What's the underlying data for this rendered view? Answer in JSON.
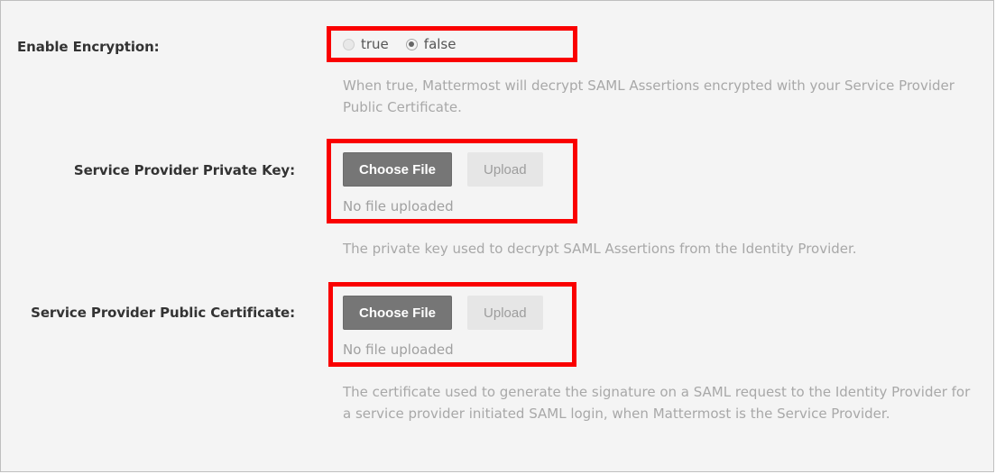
{
  "page": {
    "background_color": "#f4f4f4",
    "border_color": "#bfbfbf",
    "annotation_color": "#fa0000"
  },
  "settings": [
    {
      "id": "enable-encryption",
      "label": "Enable Encryption:",
      "type": "radio",
      "options": [
        {
          "value": "true",
          "label": "true",
          "selected": false
        },
        {
          "value": "false",
          "label": "false",
          "selected": true
        }
      ],
      "help": "When true, Mattermost will decrypt SAML Assertions encrypted with your Service Provider Public Certificate."
    },
    {
      "id": "service-provider-private-key",
      "label": "Service Provider Private Key:",
      "type": "file-upload",
      "choose_label": "Choose File",
      "upload_label": "Upload",
      "status": "No file uploaded",
      "help": "The private key used to decrypt SAML Assertions from the Identity Provider."
    },
    {
      "id": "service-provider-public-certificate",
      "label": "Service Provider Public Certificate:",
      "type": "file-upload",
      "choose_label": "Choose File",
      "upload_label": "Upload",
      "status": "No file uploaded",
      "help": "The certificate used to generate the signature on a SAML request to the Identity Provider for a service provider initiated SAML login, when Mattermost is the Service Provider."
    }
  ],
  "annotations": [
    {
      "id": "annotation-enable-encryption",
      "target": "enable-encryption-radio-group"
    },
    {
      "id": "annotation-private-key",
      "target": "private-key-upload-field"
    },
    {
      "id": "annotation-public-certificate",
      "target": "public-certificate-upload-field"
    }
  ]
}
